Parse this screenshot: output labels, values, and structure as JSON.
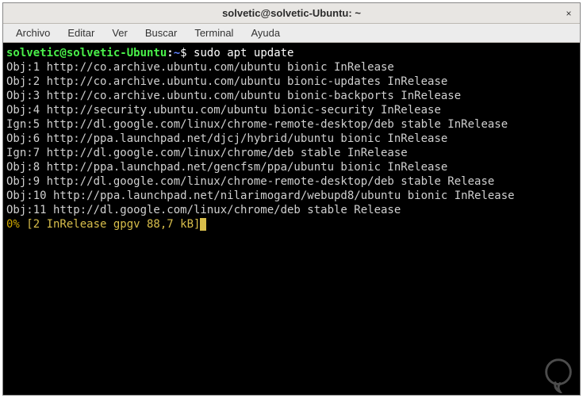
{
  "titlebar": {
    "title": "solvetic@solvetic-Ubuntu: ~",
    "close_label": "×"
  },
  "menubar": {
    "items": [
      "Archivo",
      "Editar",
      "Ver",
      "Buscar",
      "Terminal",
      "Ayuda"
    ]
  },
  "prompt": {
    "userhost": "solvetic@solvetic-Ubuntu",
    "sep": ":",
    "path": "~",
    "dollar": "$"
  },
  "command": "sudo apt update",
  "output": [
    "Obj:1 http://co.archive.ubuntu.com/ubuntu bionic InRelease",
    "Obj:2 http://co.archive.ubuntu.com/ubuntu bionic-updates InRelease",
    "Obj:3 http://co.archive.ubuntu.com/ubuntu bionic-backports InRelease",
    "Obj:4 http://security.ubuntu.com/ubuntu bionic-security InRelease",
    "Ign:5 http://dl.google.com/linux/chrome-remote-desktop/deb stable InRelease",
    "Obj:6 http://ppa.launchpad.net/djcj/hybrid/ubuntu bionic InRelease",
    "Ign:7 http://dl.google.com/linux/chrome/deb stable InRelease",
    "Obj:8 http://ppa.launchpad.net/gencfsm/ppa/ubuntu bionic InRelease",
    "Obj:9 http://dl.google.com/linux/chrome-remote-desktop/deb stable Release",
    "Obj:10 http://ppa.launchpad.net/nilarimogard/webupd8/ubuntu bionic InRelease",
    "Obj:11 http://dl.google.com/linux/chrome/deb stable Release"
  ],
  "progress": {
    "pct": "0%",
    "rest": " [2 InRelease gpgv 88,7 kB]"
  }
}
